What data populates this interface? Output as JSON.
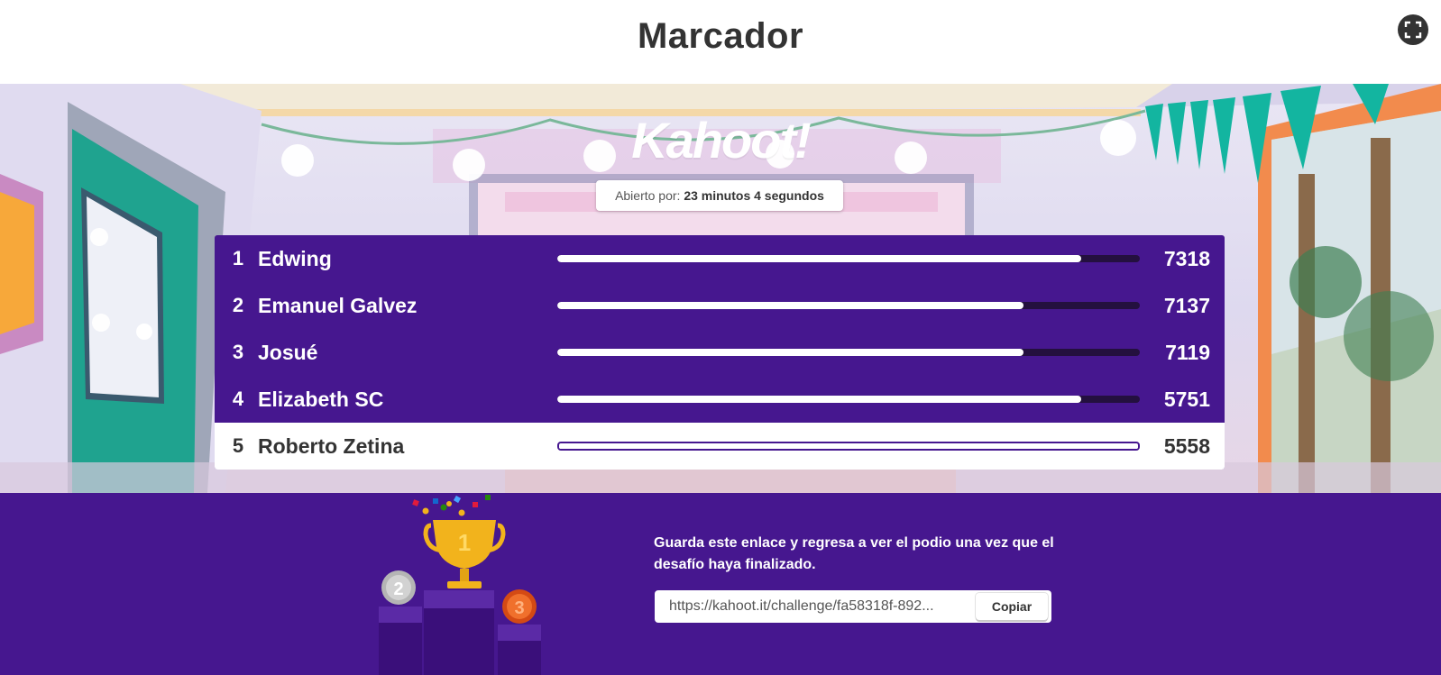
{
  "header": {
    "title": "Marcador",
    "fullscreen_icon": "fullscreen-icon"
  },
  "scene": {
    "logo": "Kahoot!",
    "opened_label": "Abierto por:",
    "opened_value": "23 minutos 4 segundos"
  },
  "leaderboard": [
    {
      "rank": "1",
      "name": "Edwing",
      "score": "7318",
      "progress": 0.9,
      "highlighted": false
    },
    {
      "rank": "2",
      "name": "Emanuel Galvez",
      "score": "7137",
      "progress": 0.8,
      "highlighted": false
    },
    {
      "rank": "3",
      "name": "Josué",
      "score": "7119",
      "progress": 0.8,
      "highlighted": false
    },
    {
      "rank": "4",
      "name": "Elizabeth SC",
      "score": "5751",
      "progress": 0.9,
      "highlighted": false
    },
    {
      "rank": "5",
      "name": "Roberto Zetina",
      "score": "5558",
      "progress": 1.0,
      "highlighted": true
    }
  ],
  "footer": {
    "message": "Guarda este enlace y regresa a ver el podio una vez que el desafío haya finalizado.",
    "link_value": "https://kahoot.it/challenge/fa58318f-892...",
    "copy_label": "Copiar",
    "podium_ranks": [
      "1",
      "2",
      "3"
    ]
  },
  "colors": {
    "brand_purple": "#46178f",
    "bar_track": "#24103f",
    "gold": "#f2b31c",
    "silver": "#c8c8c8",
    "bronze": "#e2581b"
  }
}
